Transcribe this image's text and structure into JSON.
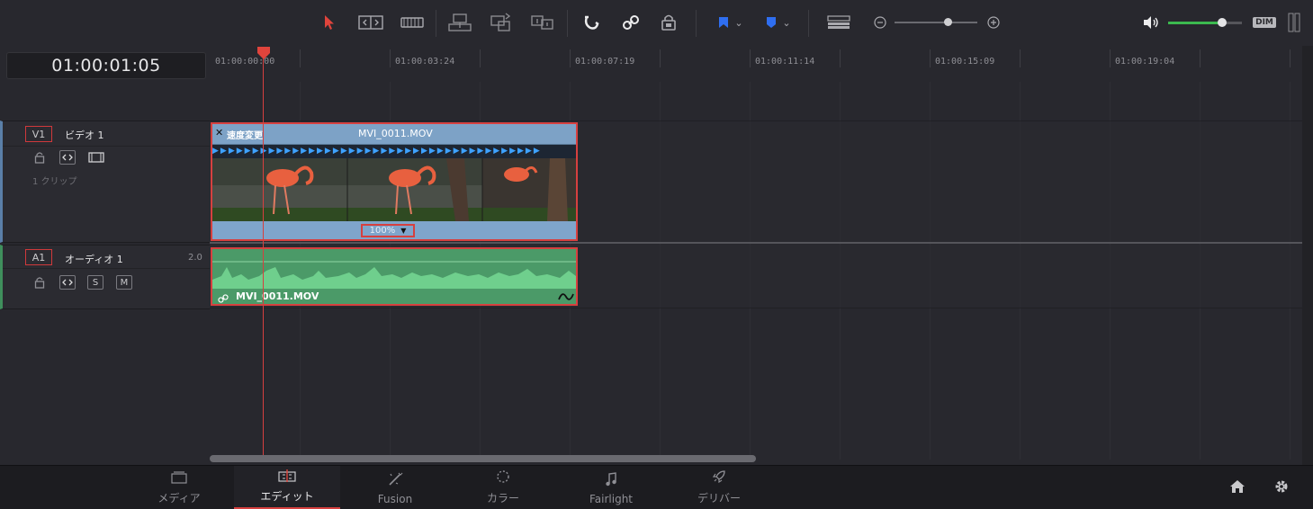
{
  "timecode": "01:00:01:05",
  "ruler": {
    "labels": [
      "01:00:00:00",
      "01:00:03:24",
      "01:00:07:19",
      "01:00:11:14",
      "01:00:15:09",
      "01:00:19:04"
    ]
  },
  "toolbar": {
    "dim_label": "DIM",
    "tools": [
      "select-icon",
      "trim-icon",
      "blade-icon",
      "insert-icon",
      "overwrite-icon",
      "replace-icon",
      "snapping-icon",
      "linked-selection-icon",
      "position-lock-icon",
      "flag-icon",
      "marker-icon",
      "timeline-view-icon",
      "zoom-out-icon",
      "zoom-in-icon",
      "volume-icon"
    ]
  },
  "tracks": {
    "video": {
      "tag": "V1",
      "name": "ビデオ 1",
      "clip_count": "1 クリップ"
    },
    "audio": {
      "tag": "A1",
      "name": "オーディオ 1",
      "channels": "2.0",
      "solo": "S",
      "mute": "M"
    }
  },
  "clips": {
    "video": {
      "badge": "速度変更",
      "name": "MVI_0011.MOV",
      "speed": "100%"
    },
    "audio": {
      "name": "MVI_0011.MOV"
    }
  },
  "pages": [
    {
      "label": "メディア",
      "icon": "media-icon"
    },
    {
      "label": "エディット",
      "icon": "edit-icon"
    },
    {
      "label": "Fusion",
      "icon": "fusion-icon"
    },
    {
      "label": "カラー",
      "icon": "color-icon"
    },
    {
      "label": "Fairlight",
      "icon": "fairlight-icon"
    },
    {
      "label": "デリバー",
      "icon": "deliver-icon"
    }
  ],
  "colors": {
    "accent": "#d6403f",
    "video_clip": "#7da2c6",
    "audio_clip": "#4b9a68",
    "speed_arrows": "#3ea2ff"
  }
}
